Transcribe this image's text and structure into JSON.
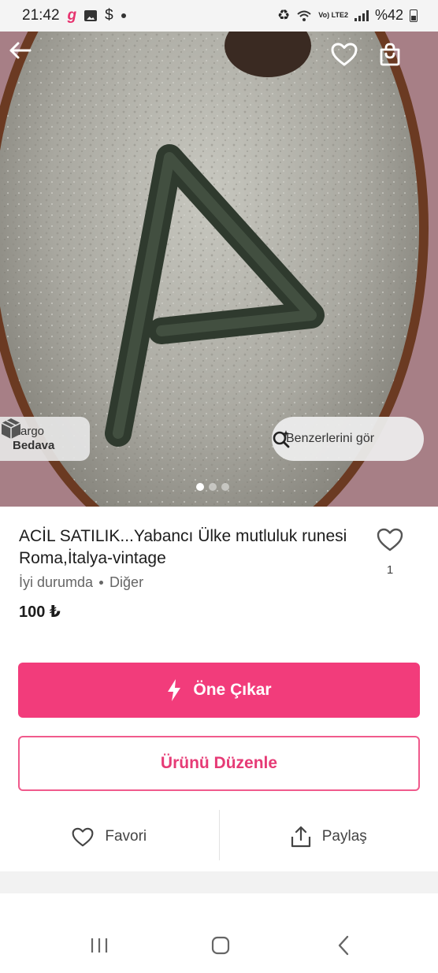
{
  "status_bar": {
    "time": "21:42",
    "network_label": "Vo) LTE2",
    "battery": "%42"
  },
  "hero": {
    "cargo_badge": {
      "line1": "Kargo",
      "line2": "Bedava"
    },
    "similar_button": "Benzerlerini gör",
    "carousel": {
      "total": 3,
      "active": 1
    }
  },
  "product": {
    "title": "ACİL SATILIK...Yabancı Ülke mutluluk runesi Roma,İtalya-vintage",
    "condition": "İyi durumda",
    "category": "Diğer",
    "price": "100 ₺",
    "like_count": "1"
  },
  "buttons": {
    "promote": "Öne Çıkar",
    "edit": "Ürünü Düzenle"
  },
  "actions": {
    "favorite": "Favori",
    "share": "Paylaş"
  },
  "colors": {
    "accent": "#f23c7b",
    "accent_text": "#e63b76"
  },
  "icons": [
    "back-arrow-icon",
    "heart-icon",
    "shopping-bag-icon",
    "box-icon",
    "visual-search-icon",
    "lightning-icon",
    "share-icon",
    "recent-apps-icon",
    "home-icon",
    "back-icon"
  ]
}
